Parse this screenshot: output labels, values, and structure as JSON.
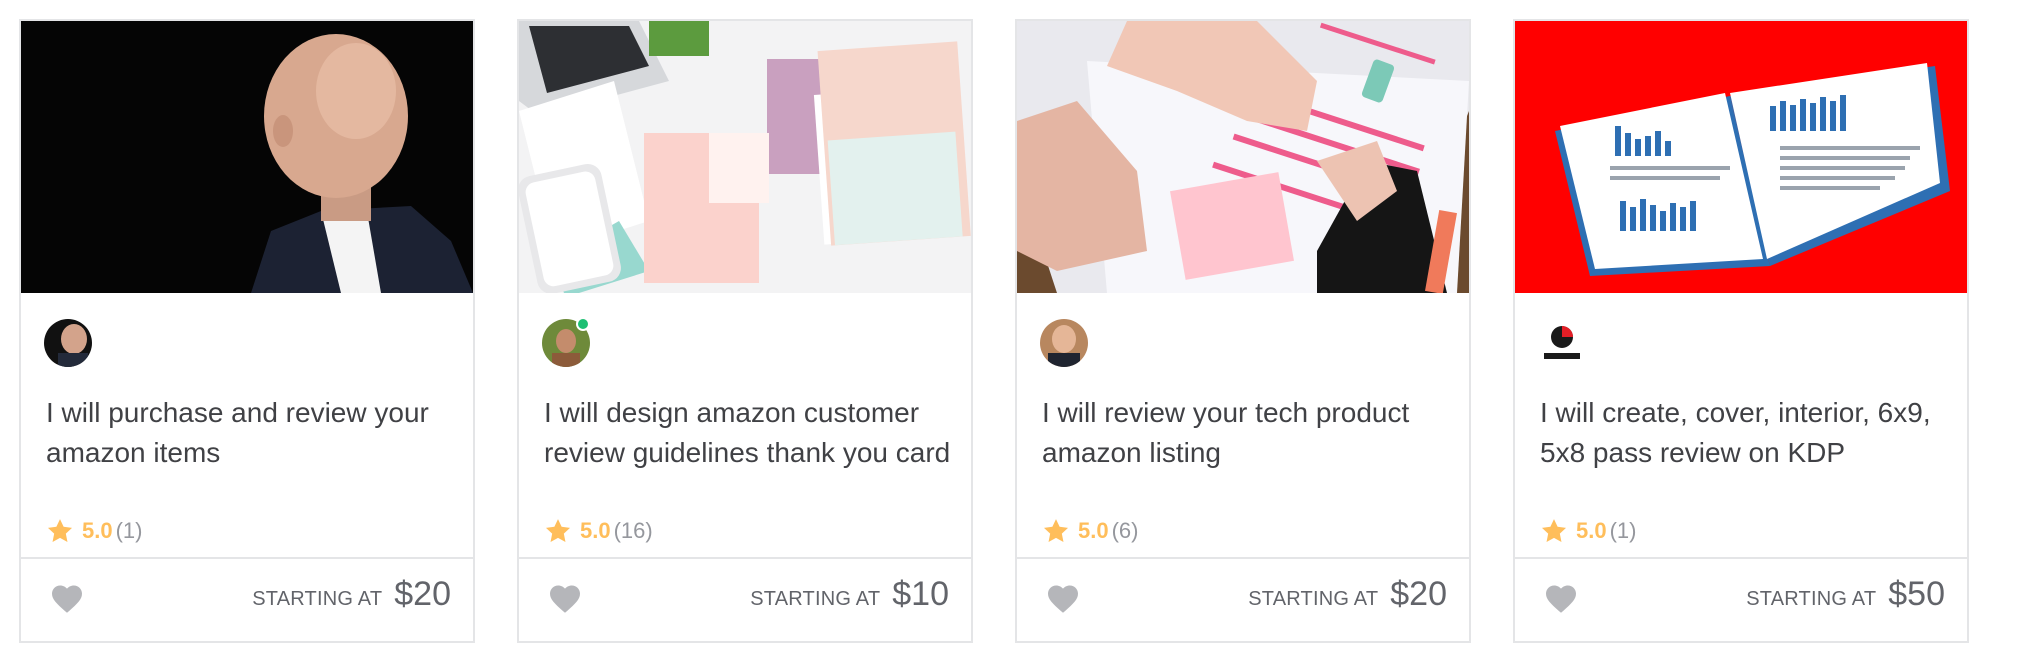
{
  "labels": {
    "starting_at": "STARTING AT"
  },
  "colors": {
    "star": "#ffbe5b",
    "heart": "#b5b6ba",
    "online": "#1dbf73",
    "border": "#e4e5e7"
  },
  "icons": {
    "rating": "star-icon",
    "favorite": "heart-icon"
  },
  "gigs": [
    {
      "seller_name": "",
      "seller_level": "",
      "online": false,
      "title": "I will purchase and review your amazon items",
      "rating": "5.0",
      "reviews": "(1)",
      "price": "$20",
      "thumbnail": "portrait of man on black background"
    },
    {
      "seller_name": "",
      "seller_level": "",
      "online": true,
      "title": "I will design amazon customer review guidelines thank you card",
      "rating": "5.0",
      "reviews": "(16)",
      "price": "$10",
      "thumbnail": "thank you cards flat lay with laptop and phone"
    },
    {
      "seller_name": "",
      "seller_level": "",
      "online": false,
      "title": "I will review your tech product amazon listing",
      "rating": "5.0",
      "reviews": "(6)",
      "price": "$20",
      "thumbnail": "hands reviewing printed documents"
    },
    {
      "seller_name": "",
      "seller_level": "",
      "online": false,
      "title": "I will create, cover, interior, 6x9, 5x8 pass review on KDP",
      "rating": "5.0",
      "reviews": "(1)",
      "price": "$50",
      "thumbnail": "open book with blue charts on red background"
    }
  ]
}
